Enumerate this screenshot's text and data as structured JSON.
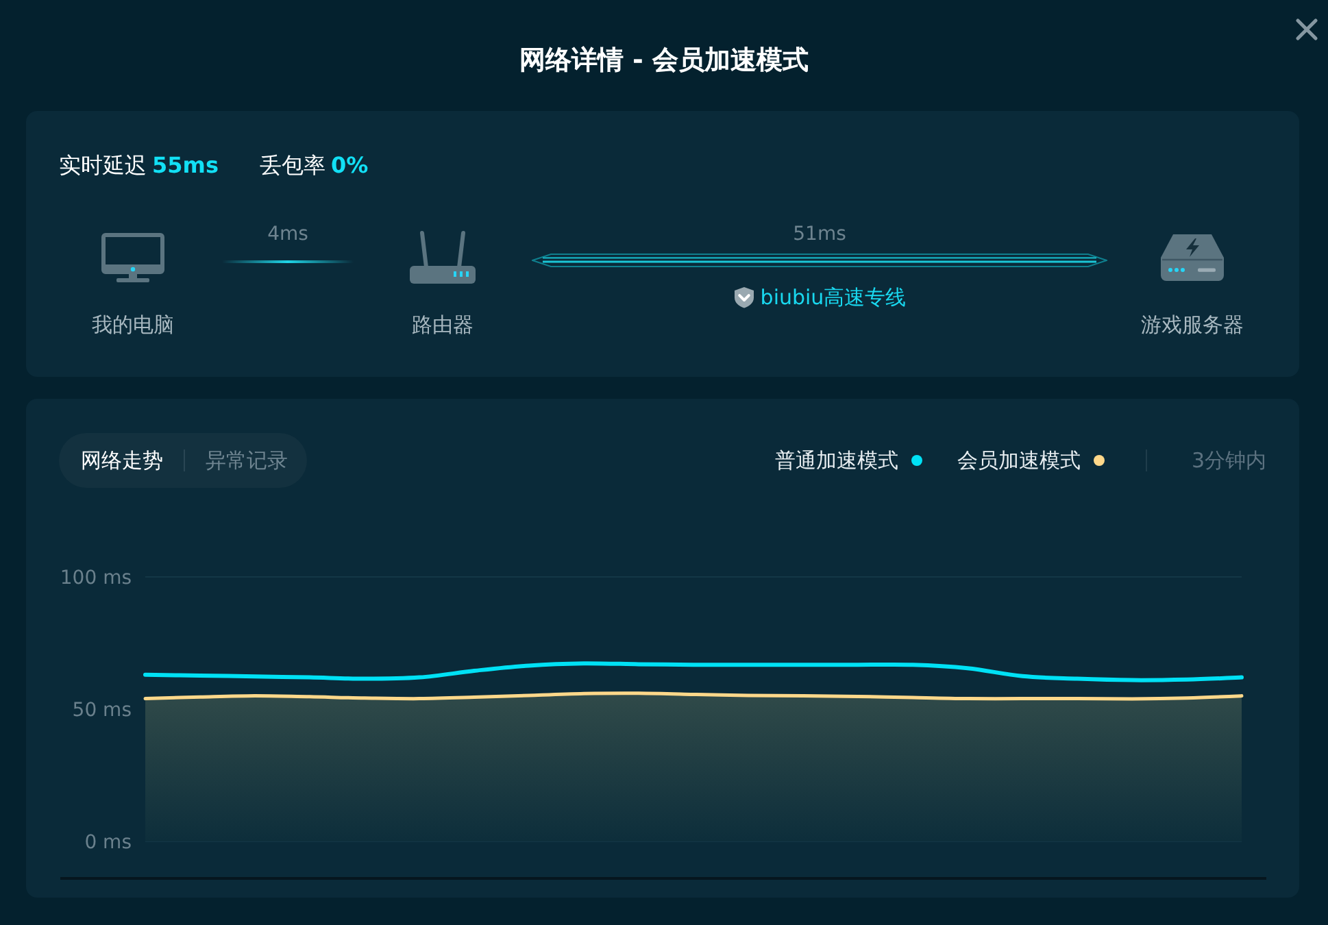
{
  "window": {
    "title": "网络详情 - 会员加速模式"
  },
  "network": {
    "stats": [
      {
        "label": "实时延迟",
        "value": "55ms"
      },
      {
        "label": "丢包率",
        "value": "0%"
      }
    ],
    "topology": [
      {
        "kind": "computer",
        "label": "我的电脑"
      },
      {
        "kind": "plain",
        "latency": "4ms"
      },
      {
        "kind": "router",
        "label": "路由器"
      },
      {
        "kind": "express",
        "latency": "51ms",
        "route": "biubiu高速专线"
      },
      {
        "kind": "server",
        "label": "游戏服务器"
      }
    ]
  },
  "trend": {
    "tabs": [
      {
        "label": "网络走势",
        "selected": true
      },
      {
        "label": "异常记录",
        "selected": false
      }
    ],
    "range": "3分钟内",
    "chart_data": {
      "type": "line",
      "ylim": [
        0,
        100
      ],
      "yticks": [
        {
          "value": 100,
          "label": "100 ms"
        },
        {
          "value": 50,
          "label": "50 ms"
        },
        {
          "value": 0,
          "label": "0 ms"
        }
      ],
      "series": [
        {
          "name": "普通加速模式",
          "color": "#00e1f5",
          "values": [
            63,
            62.7,
            62.4,
            62,
            61.5,
            62,
            64.5,
            66.5,
            67.3,
            67,
            66.8,
            66.8,
            66.8,
            66.8,
            66.8,
            65.5,
            62.5,
            61.5,
            61,
            61.2,
            62
          ]
        },
        {
          "name": "会员加速模式",
          "color": "#ffd88a",
          "values": [
            54,
            54.6,
            55,
            54.7,
            54.2,
            54,
            54.5,
            55.2,
            55.9,
            56,
            55.6,
            55.2,
            55,
            54.8,
            54.4,
            54,
            54,
            54,
            53.9,
            54.2,
            55
          ]
        }
      ]
    }
  }
}
